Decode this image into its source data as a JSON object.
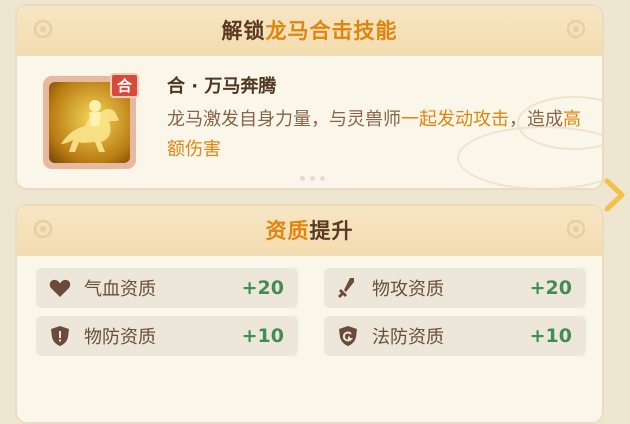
{
  "unlock_panel": {
    "title_prefix": "解锁",
    "title_highlight": "龙马合击技能",
    "skill": {
      "badge": "合",
      "name": "合 · 万马奔腾",
      "desc_part1": "龙马激发自身力量，与灵兽师",
      "desc_hl1": "一起发动攻击",
      "desc_part2": "，造成",
      "desc_hl2": "高额伤害",
      "icon": "horse-rider-icon"
    }
  },
  "aptitude_panel": {
    "title_highlight": "资质",
    "title_suffix": "提升",
    "stats": [
      {
        "label": "气血资质",
        "value": "+20",
        "icon": "heart-icon"
      },
      {
        "label": "物攻资质",
        "value": "+20",
        "icon": "sword-icon"
      },
      {
        "label": "物防资质",
        "value": "+10",
        "icon": "shield-icon"
      },
      {
        "label": "法防资质",
        "value": "+10",
        "icon": "magic-shield-icon"
      }
    ]
  },
  "colors": {
    "highlight": "#e0850e",
    "value_green": "#3f8e52",
    "title_brown": "#5a3a22"
  }
}
